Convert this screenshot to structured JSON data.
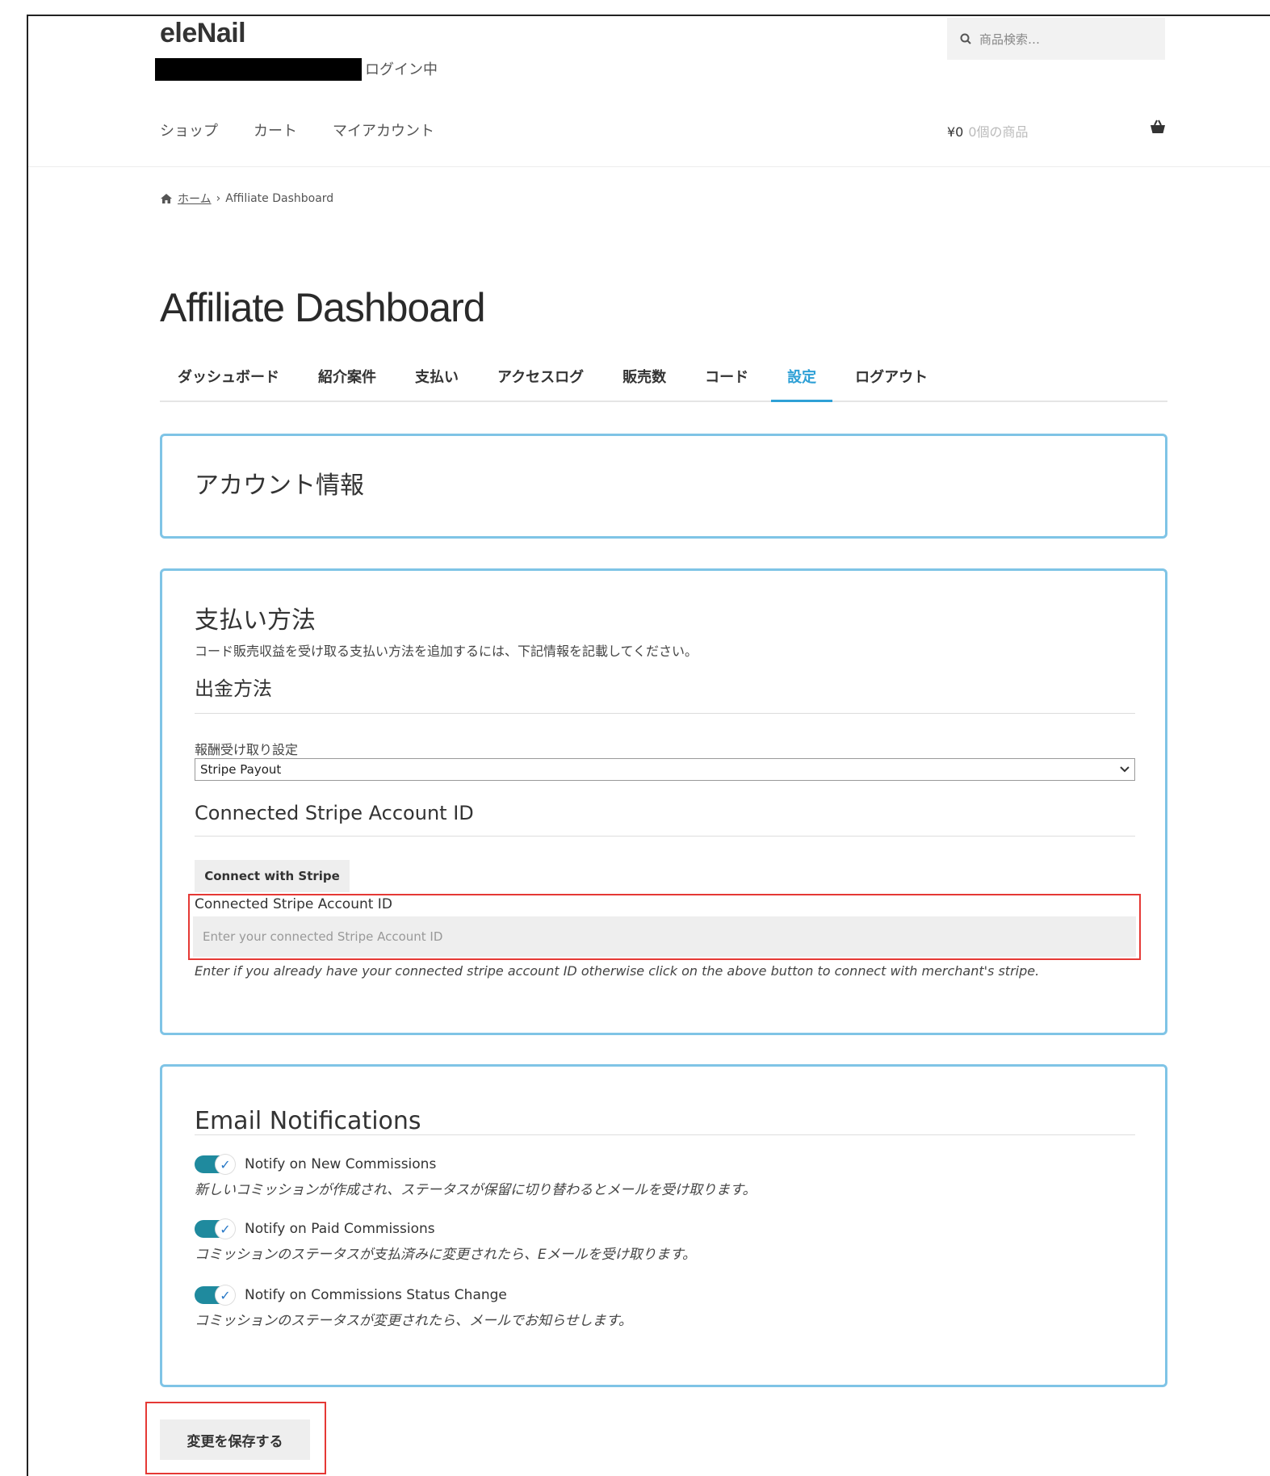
{
  "site": {
    "logo": "eleNail",
    "login_status": "ログイン中",
    "search_placeholder": "商品検索…"
  },
  "nav": {
    "items": [
      "ショップ",
      "カート",
      "マイアカウント"
    ],
    "cart_amount": "¥0",
    "cart_count": "0個の商品"
  },
  "breadcrumb": {
    "home": "ホーム",
    "separator": "›",
    "current": "Affiliate Dashboard"
  },
  "page": {
    "title": "Affiliate Dashboard"
  },
  "tabs": [
    {
      "label": "ダッシュボード"
    },
    {
      "label": "紹介案件"
    },
    {
      "label": "支払い"
    },
    {
      "label": "アクセスログ"
    },
    {
      "label": "販売数"
    },
    {
      "label": "コード"
    },
    {
      "label": "設定",
      "active": true
    },
    {
      "label": "ログアウト"
    }
  ],
  "account": {
    "title": "アカウント情報"
  },
  "payment": {
    "title": "支払い方法",
    "description": "コード販売収益を受け取る支払い方法を追加するには、下記情報を記載してください。",
    "withdrawal_title": "出金方法",
    "payout_label": "報酬受け取り設定",
    "payout_selected": "Stripe Payout",
    "stripe_title": "Connected Stripe Account ID",
    "connect_button": "Connect with Stripe",
    "account_id_label": "Connected Stripe Account ID",
    "account_id_placeholder": "Enter your connected Stripe Account ID",
    "account_id_help": "Enter if you already have your connected stripe account ID otherwise click on the above button to connect with merchant's stripe."
  },
  "email": {
    "title": "Email Notifications",
    "toggles": [
      {
        "label": "Notify on New Commissions",
        "description": "新しいコミッションが作成され、ステータスが保留に切り替わるとメールを受け取ります。",
        "checked": true
      },
      {
        "label": "Notify on Paid Commissions",
        "description": "コミッションのステータスが支払済みに変更されたら、Eメールを受け取ります。",
        "checked": true
      },
      {
        "label": "Notify on Commissions Status Change",
        "description": "コミッションのステータスが変更されたら、メールでお知らせします。",
        "checked": true
      }
    ]
  },
  "save_button": "変更を保存する",
  "colors": {
    "accent": "#2ea0d6",
    "card_border": "#7fc4e6",
    "toggle_on": "#1f8a9e",
    "highlight": "#e53935"
  }
}
